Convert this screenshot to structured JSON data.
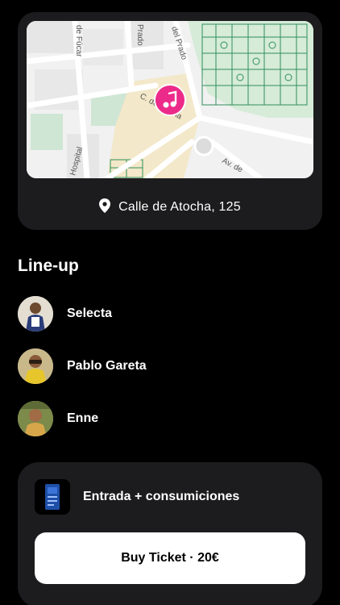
{
  "location": {
    "address": "Calle de Atocha, 125",
    "map_labels": {
      "street_1": "de Fúcar",
      "street_2": "Prado",
      "street_3": "del Prado",
      "street_4": "C. de Atocha",
      "street_5": "Hospital",
      "street_6": "Av. de"
    }
  },
  "lineup": {
    "title": "Line-up",
    "artists": [
      {
        "name": "Selecta"
      },
      {
        "name": "Pablo Gareta"
      },
      {
        "name": "Enne"
      }
    ]
  },
  "ticket": {
    "label": "Entrada + consumiciones",
    "buy_label": "Buy Ticket · 20€"
  },
  "colors": {
    "background": "#000000",
    "card": "#1c1c1e",
    "map_pin": "#ec2a8a",
    "park_line": "#2f8f5a"
  }
}
